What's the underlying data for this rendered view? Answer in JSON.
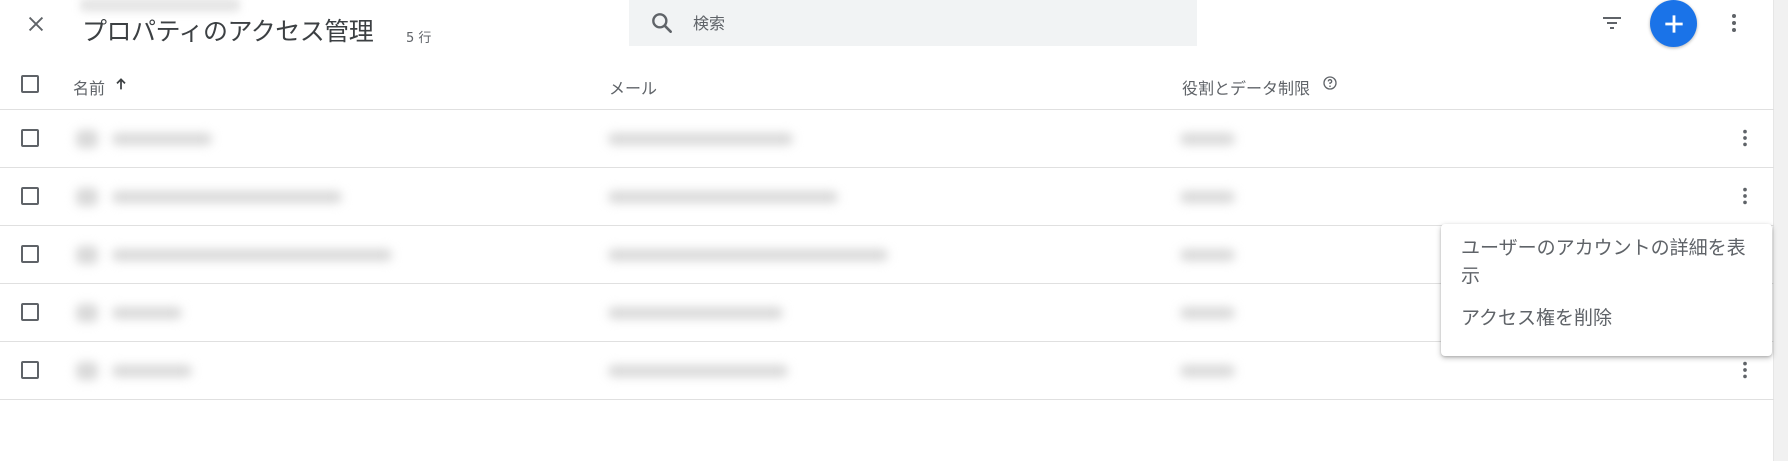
{
  "header": {
    "title": "プロパティのアクセス管理",
    "row_count": "5 行"
  },
  "search": {
    "placeholder": "検索"
  },
  "table": {
    "columns": [
      {
        "label": "名前"
      },
      {
        "label": "メール"
      },
      {
        "label": "役割とデータ制限"
      }
    ],
    "row_total": 5
  },
  "context_menu": {
    "items": [
      {
        "label": "ユーザーのアカウントの詳細を表示"
      },
      {
        "label": "アクセス権を削除"
      }
    ]
  },
  "colors": {
    "accent": "#1a73e8",
    "icon": "#5f6368",
    "divider": "#e0e0e0",
    "search_bg": "#f1f3f4"
  },
  "icons": [
    "close-icon",
    "search-icon",
    "filter-icon",
    "add-icon",
    "more-vert-icon",
    "arrow-upward-icon",
    "help-outline-icon"
  ]
}
